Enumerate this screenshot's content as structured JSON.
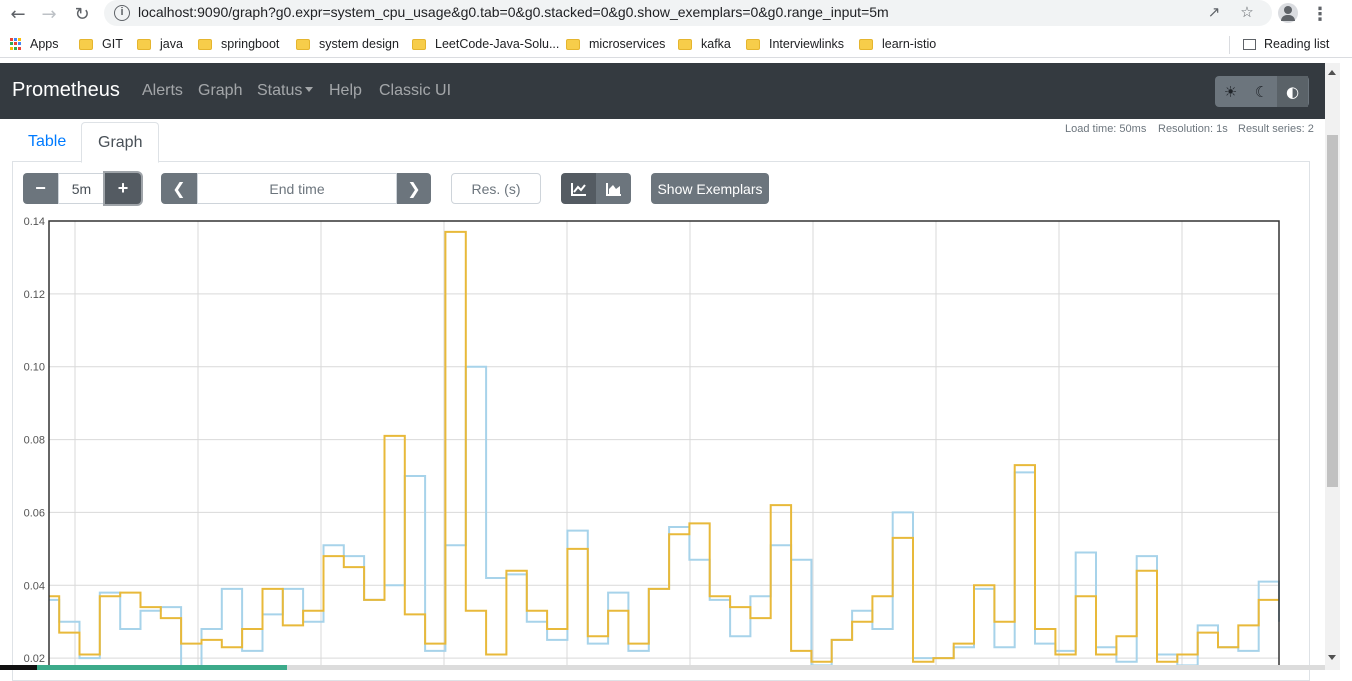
{
  "browser": {
    "url": "localhost:9090/graph?g0.expr=system_cpu_usage&g0.tab=0&g0.stacked=0&g0.show_exemplars=0&g0.range_input=5m",
    "bookmarks": [
      "Apps",
      "GIT",
      "java",
      "springboot",
      "system design",
      "LeetCode-Java-Solu...",
      "microservices",
      "kafka",
      "Interviewlinks",
      "learn-istio"
    ],
    "reading_list": "Reading list"
  },
  "navbar": {
    "brand": "Prometheus",
    "links": [
      "Alerts",
      "Graph",
      "Status",
      "Help",
      "Classic UI"
    ]
  },
  "panel": {
    "meta": {
      "load_time": "Load time: 50ms",
      "resolution": "Resolution: 1s",
      "result_series": "Result series: 2"
    },
    "tabs": {
      "table": "Table",
      "graph": "Graph"
    },
    "range_value": "5m",
    "end_time_placeholder": "End time",
    "res_placeholder": "Res. (s)",
    "show_exemplars": "Show Exemplars"
  },
  "chart_data": {
    "type": "line",
    "title": "",
    "xlabel": "",
    "ylabel": "",
    "ylim": [
      0.014,
      0.14
    ],
    "yticks": [
      "0.14",
      "0.12",
      "0.10",
      "0.08",
      "0.06",
      "0.04",
      "0.02"
    ],
    "grid": true,
    "legend": "none",
    "series": [
      {
        "color": "#a7d3ea",
        "values": [
          0.036,
          0.03,
          0.03,
          0.02,
          0.02,
          0.038,
          0.038,
          0.028,
          0.028,
          0.033,
          0.033,
          0.034,
          0.034,
          0.015,
          0.015,
          0.028,
          0.028,
          0.039,
          0.039,
          0.022,
          0.022,
          0.032,
          0.032,
          0.039,
          0.039,
          0.03,
          0.03,
          0.051,
          0.051,
          0.048,
          0.048,
          0.036,
          0.036,
          0.04,
          0.04,
          0.07,
          0.07,
          0.022,
          0.022,
          0.051,
          0.051,
          0.1,
          0.1,
          0.042,
          0.042,
          0.043,
          0.043,
          0.03,
          0.03,
          0.025,
          0.025,
          0.055,
          0.055,
          0.024,
          0.024,
          0.038,
          0.038,
          0.022,
          0.022,
          0.039,
          0.039,
          0.056,
          0.056,
          0.047,
          0.047,
          0.036,
          0.036,
          0.026,
          0.026,
          0.037,
          0.037,
          0.051,
          0.051,
          0.047,
          0.047,
          0.018,
          0.018,
          0.025,
          0.025,
          0.033,
          0.033,
          0.028,
          0.028,
          0.06,
          0.06,
          0.02,
          0.02,
          0.02,
          0.02,
          0.023,
          0.023,
          0.039,
          0.039,
          0.023,
          0.023,
          0.071,
          0.071,
          0.024,
          0.024,
          0.022,
          0.022,
          0.049,
          0.049,
          0.023,
          0.023,
          0.019,
          0.019,
          0.048,
          0.048,
          0.021,
          0.021,
          0.018,
          0.018,
          0.029,
          0.029,
          0.023,
          0.023,
          0.022,
          0.022,
          0.041,
          0.041,
          0.03
        ]
      },
      {
        "color": "#e8b93a",
        "values": [
          0.037,
          0.027,
          0.027,
          0.021,
          0.021,
          0.037,
          0.037,
          0.038,
          0.038,
          0.034,
          0.034,
          0.031,
          0.031,
          0.024,
          0.024,
          0.025,
          0.025,
          0.023,
          0.023,
          0.028,
          0.028,
          0.039,
          0.039,
          0.029,
          0.029,
          0.033,
          0.033,
          0.048,
          0.048,
          0.045,
          0.045,
          0.036,
          0.036,
          0.081,
          0.081,
          0.032,
          0.032,
          0.024,
          0.024,
          0.137,
          0.137,
          0.033,
          0.033,
          0.021,
          0.021,
          0.044,
          0.044,
          0.033,
          0.033,
          0.028,
          0.028,
          0.05,
          0.05,
          0.026,
          0.026,
          0.033,
          0.033,
          0.024,
          0.024,
          0.039,
          0.039,
          0.054,
          0.054,
          0.057,
          0.057,
          0.037,
          0.037,
          0.034,
          0.034,
          0.031,
          0.031,
          0.062,
          0.062,
          0.022,
          0.022,
          0.019,
          0.019,
          0.025,
          0.025,
          0.03,
          0.03,
          0.037,
          0.037,
          0.053,
          0.053,
          0.019,
          0.019,
          0.02,
          0.02,
          0.024,
          0.024,
          0.04,
          0.04,
          0.03,
          0.03,
          0.073,
          0.073,
          0.028,
          0.028,
          0.021,
          0.021,
          0.037,
          0.037,
          0.021,
          0.021,
          0.026,
          0.026,
          0.044,
          0.044,
          0.019,
          0.019,
          0.021,
          0.021,
          0.027,
          0.027,
          0.023,
          0.023,
          0.029,
          0.029,
          0.036,
          0.036,
          0.036
        ]
      }
    ]
  }
}
